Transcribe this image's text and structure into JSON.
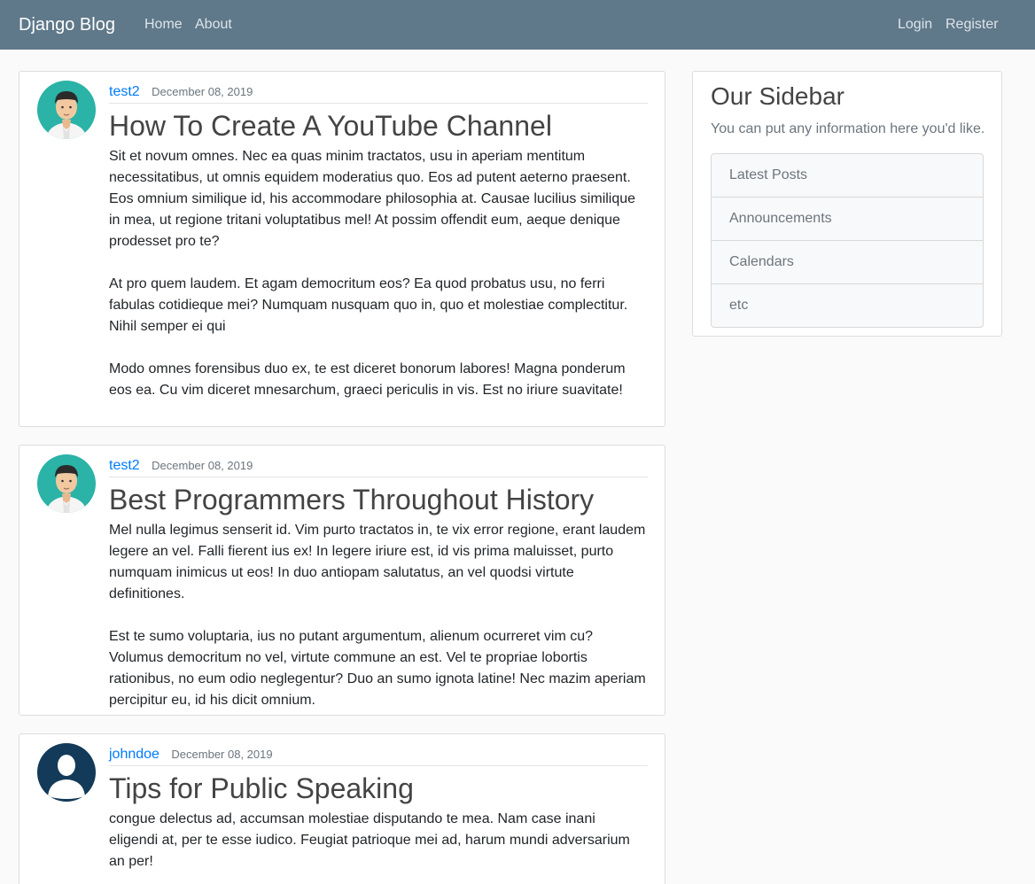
{
  "navbar": {
    "brand": "Django Blog",
    "links": [
      "Home",
      "About"
    ],
    "auth": [
      "Login",
      "Register"
    ]
  },
  "posts": [
    {
      "author": "test2",
      "date": "December 08, 2019",
      "title": "How To Create A YouTube Channel",
      "content": "Sit et novum omnes. Nec ea quas minim tractatos, usu in aperiam mentitum necessitatibus, ut omnis equidem moderatius quo. Eos ad putent aeterno praesent. Eos omnium similique id, his accommodare philosophia at. Causae lucilius similique in mea, ut regione tritani voluptatibus mel! At possim offendit eum, aeque denique prodesset pro te?\n\nAt pro quem laudem. Et agam democritum eos? Ea quod probatus usu, no ferri fabulas cotidieque mei? Numquam nusquam quo in, quo et molestiae complectitur. Nihil semper ei qui\n\nModo omnes forensibus duo ex, te est diceret bonorum labores! Magna ponderum eos ea. Cu vim diceret mnesarchum, graeci periculis in vis. Est no iriure suavitate!",
      "avatar": "male-avatar-icon"
    },
    {
      "author": "test2",
      "date": "December 08, 2019",
      "title": "Best Programmers Throughout History",
      "content": "Mel nulla legimus senserit id. Vim purto tractatos in, te vix error regione, erant laudem legere an vel. Falli fierent ius ex! In legere iriure est, id vis prima maluisset, purto numquam inimicus ut eos! In duo antiopam salutatus, an vel quodsi virtute definitiones.\n\nEst te sumo voluptaria, ius no putant argumentum, alienum ocurreret vim cu? Volumus democritum no vel, virtute commune an est. Vel te propriae lobortis rationibus, no eum odio neglegentur? Duo an sumo ignota latine! Nec mazim aperiam percipitur eu, id his dicit omnium.",
      "avatar": "male-avatar-icon"
    },
    {
      "author": "johndoe",
      "date": "December 08, 2019",
      "title": "Tips for Public Speaking",
      "content": "congue delectus ad, accumsan molestiae disputando te mea. Nam case inani eligendi at, per te esse iudico. Feugiat patrioque mei ad, harum mundi adversarium an per!",
      "avatar": "default-user-icon"
    }
  ],
  "sidebar": {
    "title": "Our Sidebar",
    "text": "You can put any information here you'd like.",
    "items": [
      "Latest Posts",
      "Announcements",
      "Calendars",
      "etc"
    ]
  },
  "colors": {
    "navbar": "#5f788a",
    "link": "#007bff",
    "avatar_teal": "#2ab3a6",
    "avatar_navy": "#133a58"
  }
}
